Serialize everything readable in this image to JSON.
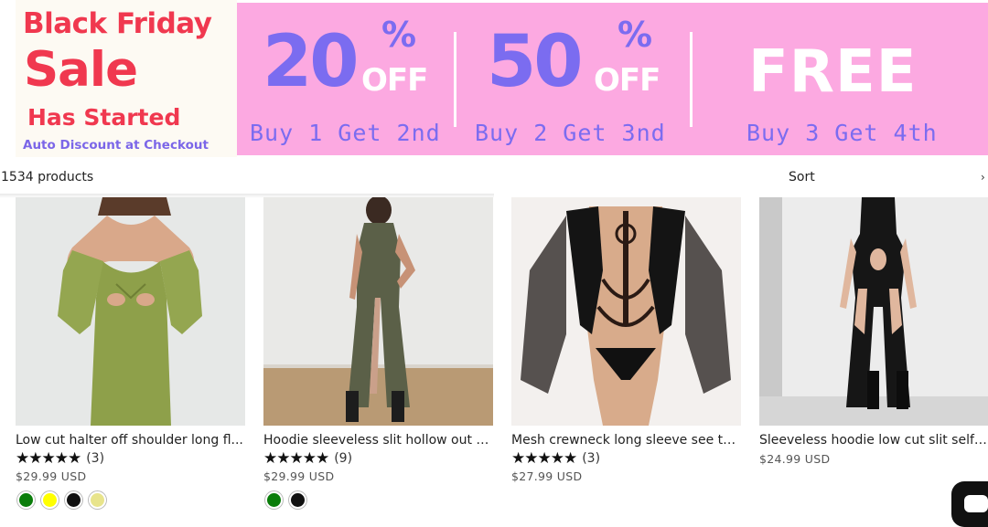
{
  "banner": {
    "headline_1": "Black Friday",
    "headline_2": "Sale",
    "headline_3": "Has Started",
    "subline": "Auto Discount at Checkout",
    "deals": [
      {
        "big": "20",
        "pct": "%",
        "off": "OFF",
        "sub": "Buy 1 Get 2nd"
      },
      {
        "big": "50",
        "pct": "%",
        "off": "OFF",
        "sub": "Buy 2 Get 3nd"
      },
      {
        "big": "FREE",
        "sub": "Buy 3 Get 4th"
      }
    ],
    "colors": {
      "red": "#f0384f",
      "purple": "#7b6cf0",
      "pink": "#fca9e1"
    }
  },
  "toolbar": {
    "count": "1534 products",
    "sort_label": "Sort"
  },
  "products": [
    {
      "title": "Low cut halter off shoulder long fl...",
      "stars": "★★★★★",
      "reviews": "(3)",
      "price": "$29.99 USD",
      "swatches": [
        "#0a7d0a",
        "#ffff00",
        "#111111",
        "#e8e48c"
      ]
    },
    {
      "title": "Hoodie sleeveless slit hollow out s...",
      "stars": "★★★★★",
      "reviews": "(9)",
      "price": "$29.99 USD",
      "swatches": [
        "#0a7d0a",
        "#111111"
      ]
    },
    {
      "title": "Mesh crewneck long sleeve see th...",
      "stars": "★★★★★",
      "reviews": "(3)",
      "price": "$27.99 USD",
      "swatches": []
    },
    {
      "title": "Sleeveless hoodie low cut slit self ...",
      "stars": "",
      "reviews": "",
      "price": "$24.99 USD",
      "swatches": []
    }
  ]
}
